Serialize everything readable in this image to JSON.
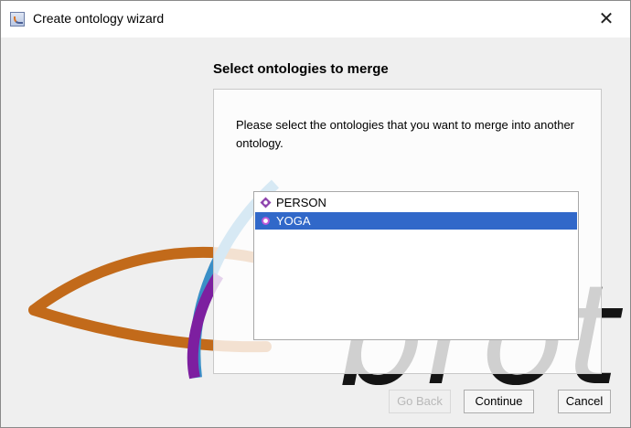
{
  "window": {
    "title": "Create ontology wizard",
    "close_glyph": "✕"
  },
  "background": {
    "watermark_text": "prot"
  },
  "wizard": {
    "heading": "Select ontologies to merge",
    "instruction": "Please select the ontologies that you want to merge into another ontology.",
    "ontologies": [
      {
        "label": "PERSON",
        "icon": "ontology-diamond-icon",
        "selected": false
      },
      {
        "label": "YOGA",
        "icon": "ontology-circle-icon",
        "selected": true
      }
    ]
  },
  "buttons": {
    "back": "Go Back",
    "continue": "Continue",
    "cancel": "Cancel"
  },
  "colors": {
    "selection": "#3168c9",
    "accent_purple": "#8e44ad"
  }
}
